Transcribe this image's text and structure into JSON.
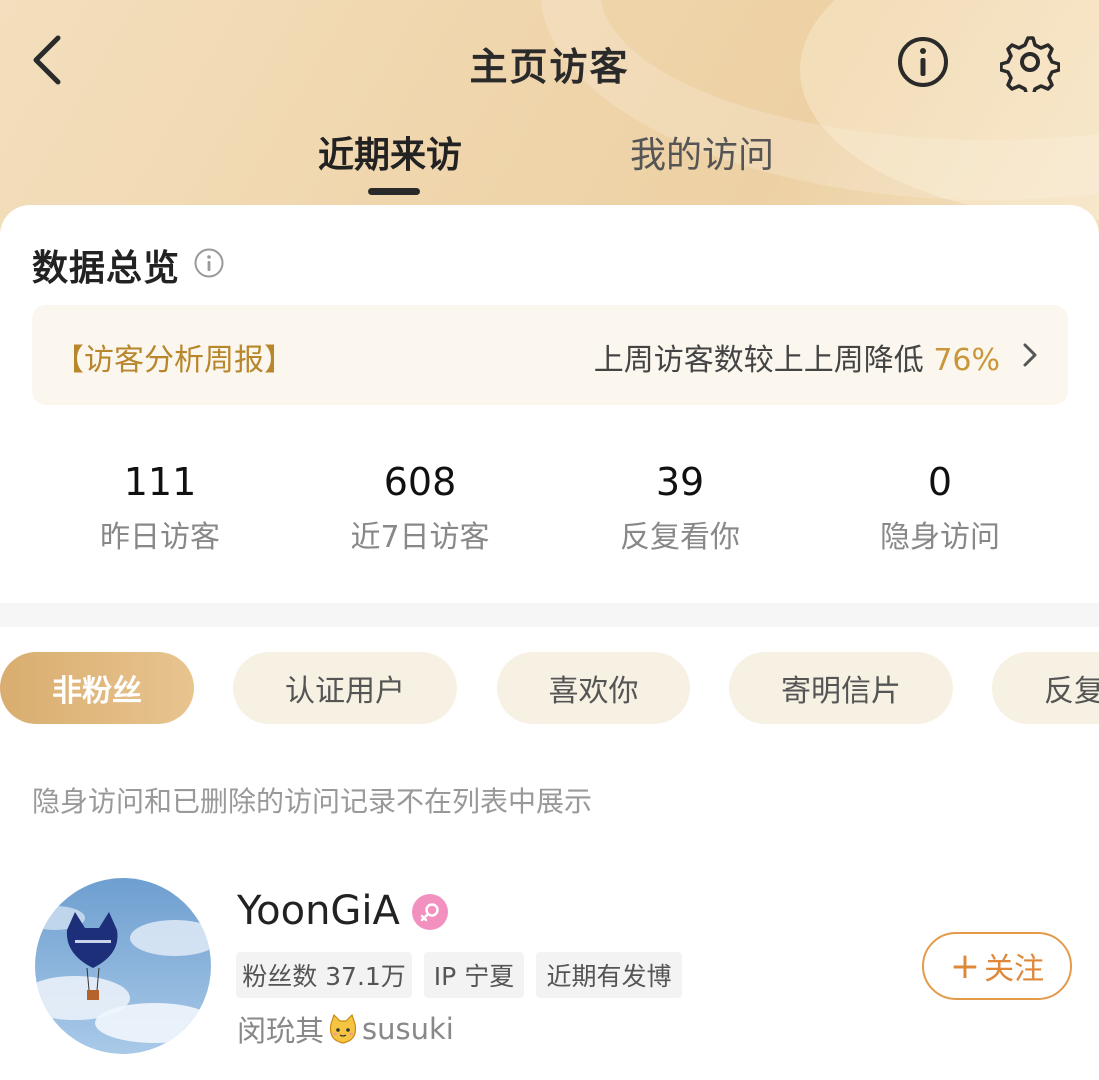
{
  "header": {
    "title": "主页访客",
    "back_icon": "chevron-left-icon",
    "info_icon": "info-circle-icon",
    "settings_icon": "gear-icon"
  },
  "tabs": [
    {
      "label": "近期来访",
      "active": true
    },
    {
      "label": "我的访问",
      "active": false
    }
  ],
  "overview": {
    "title": "数据总览",
    "report_tag": "【访客分析周报】",
    "report_text": "上周访客数较上上周降低",
    "report_percent": "76%",
    "stats": [
      {
        "value": "111",
        "label": "昨日访客"
      },
      {
        "value": "608",
        "label": "近7日访客"
      },
      {
        "value": "39",
        "label": "反复看你"
      },
      {
        "value": "0",
        "label": "隐身访问"
      }
    ]
  },
  "filters": [
    {
      "label": "非粉丝",
      "active": true
    },
    {
      "label": "认证用户",
      "active": false
    },
    {
      "label": "喜欢你",
      "active": false
    },
    {
      "label": "寄明信片",
      "active": false
    },
    {
      "label": "反复",
      "active": false
    }
  ],
  "notice": "隐身访问和已删除的访问记录不在列表中展示",
  "visitors": [
    {
      "name": "YoonGiA",
      "gender_badge": "female-icon",
      "tags": [
        "粉丝数 37.1万",
        "IP 宁夏",
        "近期有发博"
      ],
      "desc_prefix": "闵玧其",
      "desc_suffix": "susuki",
      "follow_label": "关注"
    }
  ],
  "colors": {
    "accent": "#e0883a",
    "report_tag": "#b8862b",
    "chip_active": "#d9ad6f",
    "chip_bg": "#f7f1e4",
    "header_bg": "#f0d6ad"
  }
}
